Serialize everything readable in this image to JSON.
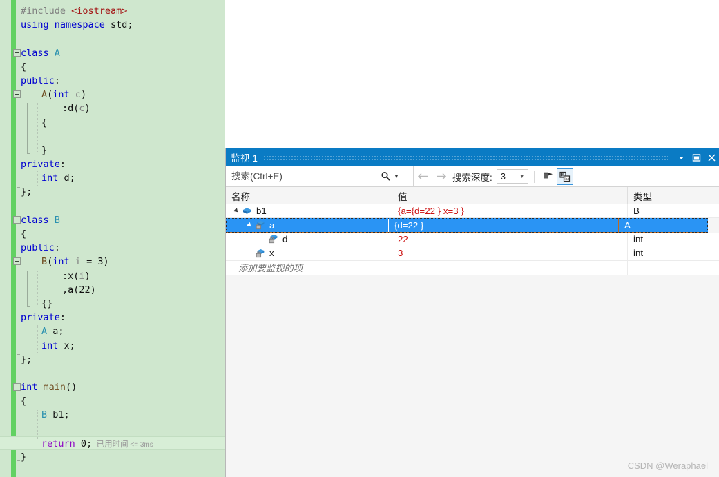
{
  "editor": {
    "lines": [
      {
        "indent": 0,
        "fold": false,
        "tokens": [
          {
            "t": "#include ",
            "c": "pp"
          },
          {
            "t": "<iostream>",
            "c": "str"
          }
        ]
      },
      {
        "indent": 0,
        "fold": false,
        "tokens": [
          {
            "t": "using namespace ",
            "c": "kw"
          },
          {
            "t": "std",
            "c": "id"
          },
          {
            "t": ";",
            "c": "punct"
          }
        ]
      },
      {
        "indent": 0,
        "fold": false,
        "tokens": []
      },
      {
        "indent": 0,
        "fold": true,
        "tokens": [
          {
            "t": "class ",
            "c": "kw"
          },
          {
            "t": "A",
            "c": "ty"
          }
        ]
      },
      {
        "indent": 0,
        "fold": false,
        "tokens": [
          {
            "t": "{",
            "c": "punct"
          }
        ]
      },
      {
        "indent": 0,
        "fold": false,
        "tokens": [
          {
            "t": "public",
            "c": "kw"
          },
          {
            "t": ":",
            "c": "punct"
          }
        ]
      },
      {
        "indent": 1,
        "fold": true,
        "tokens": [
          {
            "t": "A",
            "c": "fn"
          },
          {
            "t": "(",
            "c": "punct"
          },
          {
            "t": "int ",
            "c": "kw"
          },
          {
            "t": "c",
            "c": "par"
          },
          {
            "t": ")",
            "c": "punct"
          }
        ]
      },
      {
        "indent": 2,
        "fold": false,
        "tokens": [
          {
            "t": ":d(",
            "c": "punct"
          },
          {
            "t": "c",
            "c": "par"
          },
          {
            "t": ")",
            "c": "punct"
          }
        ]
      },
      {
        "indent": 1,
        "fold": false,
        "tokens": [
          {
            "t": "{",
            "c": "punct"
          }
        ]
      },
      {
        "indent": 1,
        "fold": false,
        "tokens": []
      },
      {
        "indent": 1,
        "fold": false,
        "tokens": [
          {
            "t": "}",
            "c": "punct"
          }
        ]
      },
      {
        "indent": 0,
        "fold": false,
        "tokens": [
          {
            "t": "private",
            "c": "kw"
          },
          {
            "t": ":",
            "c": "punct"
          }
        ]
      },
      {
        "indent": 1,
        "fold": false,
        "tokens": [
          {
            "t": "int ",
            "c": "kw"
          },
          {
            "t": "d;",
            "c": "punct"
          }
        ]
      },
      {
        "indent": 0,
        "fold": false,
        "tokens": [
          {
            "t": "};",
            "c": "punct"
          }
        ]
      },
      {
        "indent": 0,
        "fold": false,
        "tokens": []
      },
      {
        "indent": 0,
        "fold": true,
        "tokens": [
          {
            "t": "class ",
            "c": "kw"
          },
          {
            "t": "B",
            "c": "ty"
          }
        ]
      },
      {
        "indent": 0,
        "fold": false,
        "tokens": [
          {
            "t": "{",
            "c": "punct"
          }
        ]
      },
      {
        "indent": 0,
        "fold": false,
        "tokens": [
          {
            "t": "public",
            "c": "kw"
          },
          {
            "t": ":",
            "c": "punct"
          }
        ]
      },
      {
        "indent": 1,
        "fold": true,
        "tokens": [
          {
            "t": "B",
            "c": "fn"
          },
          {
            "t": "(",
            "c": "punct"
          },
          {
            "t": "int ",
            "c": "kw"
          },
          {
            "t": "i",
            "c": "par"
          },
          {
            "t": " = ",
            "c": "punct"
          },
          {
            "t": "3",
            "c": "num"
          },
          {
            "t": ")",
            "c": "punct"
          }
        ]
      },
      {
        "indent": 2,
        "fold": false,
        "tokens": [
          {
            "t": ":x(",
            "c": "punct"
          },
          {
            "t": "i",
            "c": "par"
          },
          {
            "t": ")",
            "c": "punct"
          }
        ]
      },
      {
        "indent": 2,
        "fold": false,
        "tokens": [
          {
            "t": ",a(",
            "c": "punct"
          },
          {
            "t": "22",
            "c": "num"
          },
          {
            "t": ")",
            "c": "punct"
          }
        ]
      },
      {
        "indent": 1,
        "fold": false,
        "tokens": [
          {
            "t": "{}",
            "c": "punct"
          }
        ]
      },
      {
        "indent": 0,
        "fold": false,
        "tokens": [
          {
            "t": "private",
            "c": "kw"
          },
          {
            "t": ":",
            "c": "punct"
          }
        ]
      },
      {
        "indent": 1,
        "fold": false,
        "tokens": [
          {
            "t": "A ",
            "c": "ty"
          },
          {
            "t": "a;",
            "c": "punct"
          }
        ]
      },
      {
        "indent": 1,
        "fold": false,
        "tokens": [
          {
            "t": "int ",
            "c": "kw"
          },
          {
            "t": "x;",
            "c": "punct"
          }
        ]
      },
      {
        "indent": 0,
        "fold": false,
        "tokens": [
          {
            "t": "};",
            "c": "punct"
          }
        ]
      },
      {
        "indent": 0,
        "fold": false,
        "tokens": []
      },
      {
        "indent": 0,
        "fold": true,
        "tokens": [
          {
            "t": "int ",
            "c": "kw"
          },
          {
            "t": "main",
            "c": "fn"
          },
          {
            "t": "()",
            "c": "punct"
          }
        ]
      },
      {
        "indent": 0,
        "fold": false,
        "tokens": [
          {
            "t": "{",
            "c": "punct"
          }
        ]
      },
      {
        "indent": 1,
        "fold": false,
        "tokens": [
          {
            "t": "B ",
            "c": "ty"
          },
          {
            "t": "b1;",
            "c": "punct"
          }
        ]
      },
      {
        "indent": 1,
        "fold": false,
        "tokens": []
      },
      {
        "indent": 1,
        "fold": false,
        "highlight": true,
        "elapsed": "已用时间",
        "elapsed_ms": "<= 3ms",
        "tokens": [
          {
            "t": "return ",
            "c": "ret"
          },
          {
            "t": "0",
            "c": "num"
          },
          {
            "t": ";",
            "c": "punct"
          }
        ]
      },
      {
        "indent": 0,
        "fold": false,
        "tokens": [
          {
            "t": "}",
            "c": "punct"
          }
        ]
      }
    ]
  },
  "watch": {
    "title": "监视 1",
    "titlebar_buttons": {
      "dropdown": "dropdown-arrow",
      "maximize": "float-window",
      "close": "×"
    },
    "toolbar": {
      "search_placeholder": "搜索(Ctrl+E)",
      "search_value": "",
      "search_icon": "magnifier-icon",
      "search_dropdown_icon": "chevron-down-icon",
      "back_icon": "←",
      "forward_icon": "→",
      "depth_label": "搜索深度:",
      "depth_value": "3",
      "depth_caret_icon": "chevron-down-icon",
      "pin_icon": "pin-properties-icon",
      "hex_icon": "hex-display-icon"
    },
    "columns": [
      "名称",
      "值",
      "类型"
    ],
    "rows": [
      {
        "depth": 0,
        "expander": "▲",
        "icon": "struct-icon",
        "name": "b1",
        "value": "{a={d=22 } x=3 }",
        "type": "B",
        "selected": false
      },
      {
        "depth": 1,
        "expander": "▲",
        "icon": "private-field-icon",
        "name": "a",
        "value": "{d=22 }",
        "type": "A",
        "selected": true
      },
      {
        "depth": 2,
        "expander": "",
        "icon": "private-field-icon",
        "name": "d",
        "value": "22",
        "type": "int",
        "selected": false
      },
      {
        "depth": 1,
        "expander": "",
        "icon": "private-field-icon",
        "name": "x",
        "value": "3",
        "type": "int",
        "selected": false
      }
    ],
    "add_item_placeholder": "添加要监视的项"
  },
  "watermark": "CSDN @Weraphael",
  "colors": {
    "editor_background": "#cfe7ce",
    "gutter_saved_marker": "#62d162",
    "titlebar": "#0a7bc4",
    "selection": "#2a94f4",
    "value_text": "#cc1111",
    "keyword": "#0000d0",
    "type": "#2b91af"
  }
}
